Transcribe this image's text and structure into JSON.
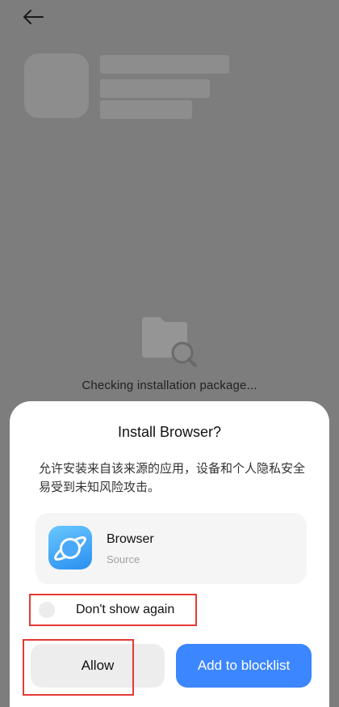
{
  "background_page": {
    "back_icon": "arrow-left-icon",
    "illustration_icon": "folder-search-icon",
    "status_text": "Checking installation package..."
  },
  "dialog": {
    "title": "Install Browser?",
    "message": "允许安装来自该来源的应用，设备和个人隐私安全易受到未知风险攻击。",
    "app": {
      "name": "Browser",
      "source": "Source",
      "icon": "browser-planet-icon"
    },
    "dont_show_again": {
      "label": "Don't show again",
      "checked": false
    },
    "buttons": {
      "allow": "Allow",
      "blocklist": "Add to blocklist"
    }
  },
  "colors": {
    "overlay": "#7d7d7d",
    "accent_blue": "#3c86ff",
    "highlight_red": "#e53935"
  }
}
